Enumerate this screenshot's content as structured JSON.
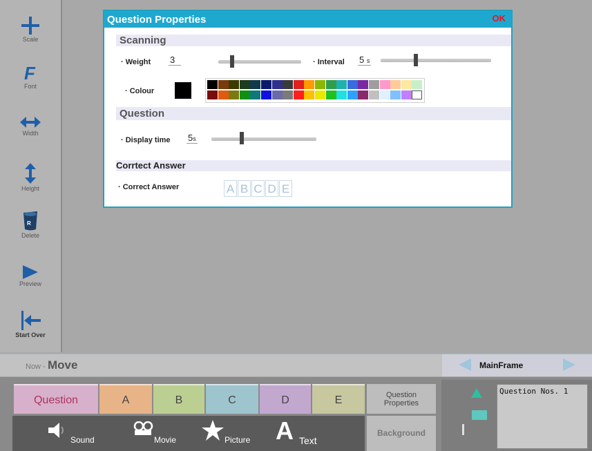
{
  "sidebar": {
    "tools": [
      {
        "label": "Scale",
        "icon": "plus-icon"
      },
      {
        "label": "Font",
        "icon": "font-f-icon"
      },
      {
        "label": "Width",
        "icon": "horizontal-arrows-icon"
      },
      {
        "label": "Height",
        "icon": "vertical-arrows-icon"
      },
      {
        "label": "Delete",
        "icon": "trash-icon"
      },
      {
        "label": "Preview",
        "icon": "play-icon"
      },
      {
        "label": "Start Over",
        "icon": "start-over-icon"
      }
    ]
  },
  "dialog": {
    "title": "Question Properties",
    "ok_label": "OK",
    "scanning": {
      "heading": "Scanning",
      "weight_label": "· Weight",
      "weight_value": "3",
      "interval_label": "· Interval",
      "interval_value": "5",
      "interval_unit": "s",
      "colour_label": "· Colour",
      "selected_colour": "#000000",
      "palette_row1": [
        "#000000",
        "#7a3a0a",
        "#3b3b00",
        "#1d3b1d",
        "#0f3b4a",
        "#0c1a6e",
        "#2f2f8e",
        "#3a3a3a",
        "#e02020",
        "#ff9a00",
        "#8ab800",
        "#2e9e4e",
        "#20b0b0",
        "#3a6be0",
        "#7a2aa0",
        "#9e9e9e",
        "#ff99cc",
        "#ffcc99",
        "#ffe8a0",
        "#c8f0c8"
      ],
      "palette_row2": [
        "#7a0c0c",
        "#e05a10",
        "#7a7a10",
        "#109010",
        "#107878",
        "#1010e0",
        "#6a6aaa",
        "#7a7a7a",
        "#ff2020",
        "#ffc000",
        "#e8e800",
        "#20c020",
        "#20e0e0",
        "#30a0ff",
        "#8a2a6a",
        "#c0c0c0",
        "#e0f0ff",
        "#80c0ff",
        "#c080ff",
        "#ffffff"
      ]
    },
    "question": {
      "heading": "Question",
      "display_time_label": "· Display time",
      "display_time_value": "5",
      "display_time_unit": "s"
    },
    "correct_answer": {
      "heading": "Corrtect Answer",
      "label": "· Correct Answer",
      "options": [
        "A",
        "B",
        "C",
        "D",
        "E"
      ]
    }
  },
  "modebar": {
    "now_label": "Now -",
    "mode": "Move",
    "frame_name": "MainFrame"
  },
  "bottom": {
    "tabs": [
      {
        "label": "Question",
        "color": "#d7b1cb",
        "text": "#b03060"
      },
      {
        "label": "A",
        "color": "#e8b487",
        "text": "#444"
      },
      {
        "label": "B",
        "color": "#bccf93",
        "text": "#444"
      },
      {
        "label": "C",
        "color": "#9ec4cd",
        "text": "#444"
      },
      {
        "label": "D",
        "color": "#c2a8cf",
        "text": "#444"
      },
      {
        "label": "E",
        "color": "#c7c7a0",
        "text": "#444"
      }
    ],
    "question_properties_label": "Question Properties",
    "background_label": "Background",
    "media": [
      {
        "label": "Sound",
        "icon": "speaker-icon"
      },
      {
        "label": "Movie",
        "icon": "film-camera-icon"
      },
      {
        "label": "Picture",
        "icon": "star-icon"
      },
      {
        "label": "Text",
        "icon": "letter-a-icon"
      }
    ],
    "question_nos": "Question Nos. 1"
  }
}
